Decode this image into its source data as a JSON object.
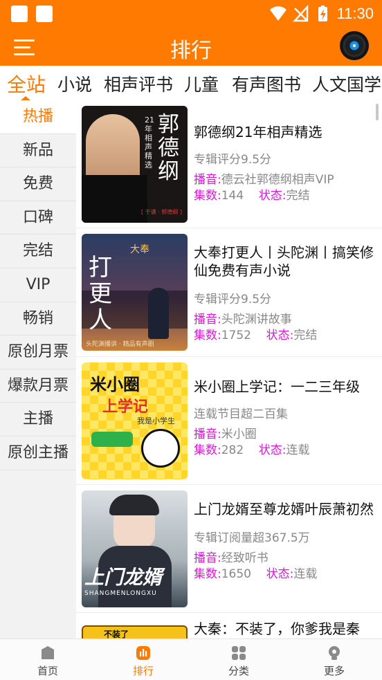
{
  "status_bar": {
    "time": "11:30"
  },
  "header": {
    "title": "排行"
  },
  "category_tabs": [
    {
      "label": "全站",
      "active": true
    },
    {
      "label": "小说"
    },
    {
      "label": "相声评书"
    },
    {
      "label": "儿童"
    },
    {
      "label": "有声图书"
    },
    {
      "label": "人文国学"
    }
  ],
  "side_menu": [
    {
      "label": "热播",
      "active": true
    },
    {
      "label": "新品"
    },
    {
      "label": "免费"
    },
    {
      "label": "口碑"
    },
    {
      "label": "完结"
    },
    {
      "label": "VIP"
    },
    {
      "label": "畅销"
    },
    {
      "label": "原创月票"
    },
    {
      "label": "爆款月票"
    },
    {
      "label": "主播"
    },
    {
      "label": "原创主播"
    }
  ],
  "labels": {
    "anchor": "播音:",
    "episodes": "集数:",
    "status": "状态:"
  },
  "albums": [
    {
      "title": "郭德纲21年相声精选",
      "subtitle": "专辑评分9.5分",
      "anchor": "德云社郭德纲相声VIP",
      "episodes": "144",
      "status": "完结",
      "cover_text": "郭德纲",
      "cover_side": "21年相声精选",
      "cover_stamp": "[ 于谦 · 郭德纲 ]"
    },
    {
      "title": "大奉打更人丨头陀渊丨搞笑修仙免费有声小说",
      "subtitle": "专辑评分9.5分",
      "anchor": "头陀渊讲故事",
      "episodes": "1752",
      "status": "完结",
      "cover_text": "打更人",
      "cover_top": "大奉",
      "cover_bottom": "头陀渊播讲 · 精品有声剧"
    },
    {
      "title": "米小圈上学记：一二三年级",
      "subtitle": "连载节目超二百集",
      "anchor": "米小圈",
      "episodes": "282",
      "status": "连载",
      "cover_text": "米小圈",
      "cover_sub": "上学记",
      "cover_note": "我是小学生"
    },
    {
      "title": "上门龙婿至尊龙婿叶辰萧初然",
      "subtitle": "专辑订阅量超367.5万",
      "anchor": "经致听书",
      "episodes": "1650",
      "status": "连载",
      "cover_text": "上门龙婿",
      "cover_pinyin": "SHANGMENLONGXU"
    },
    {
      "title": "大秦：不装了，你爹我是秦",
      "cover_text": "不装了"
    }
  ],
  "bottom_nav": [
    {
      "label": "首页",
      "icon": "home-icon"
    },
    {
      "label": "排行",
      "icon": "ranking-icon",
      "active": true
    },
    {
      "label": "分类",
      "icon": "category-icon"
    },
    {
      "label": "更多",
      "icon": "more-icon"
    }
  ],
  "colors": {
    "brand": "#ff7a00",
    "label": "#d81ad8"
  }
}
